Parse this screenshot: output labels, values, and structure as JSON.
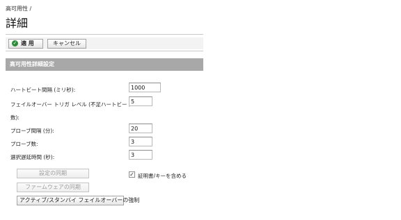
{
  "breadcrumb": "高可用性 /",
  "page_title": "詳細",
  "toolbar": {
    "apply_label": "適 用",
    "cancel_label": "キャンセル"
  },
  "section": {
    "title": "高可用性詳細設定"
  },
  "fields": {
    "heartbeat_interval": {
      "label": "ハートビート間隔 (ミリ秒):",
      "value": "1000"
    },
    "failover_trigger": {
      "label_line1": "フェイルオーバー トリガ レベル (不足ハートビート",
      "label_line2": "数):",
      "value": "5"
    },
    "probe_interval": {
      "label": "プローブ間隔 (分):",
      "value": "20"
    },
    "probe_count": {
      "label": "プローブ数:",
      "value": "3"
    },
    "election_delay": {
      "label": "選択遅延時間 (秒):",
      "value": "3"
    }
  },
  "actions": {
    "sync_settings": "設定の同期",
    "sync_firmware": "ファームウェアの同期",
    "force_failover": "アクティブ/スタンバイ フェイルオーバーの強制"
  },
  "include_cert_keys": {
    "label": "証明書/キーを含める",
    "checked": true
  }
}
